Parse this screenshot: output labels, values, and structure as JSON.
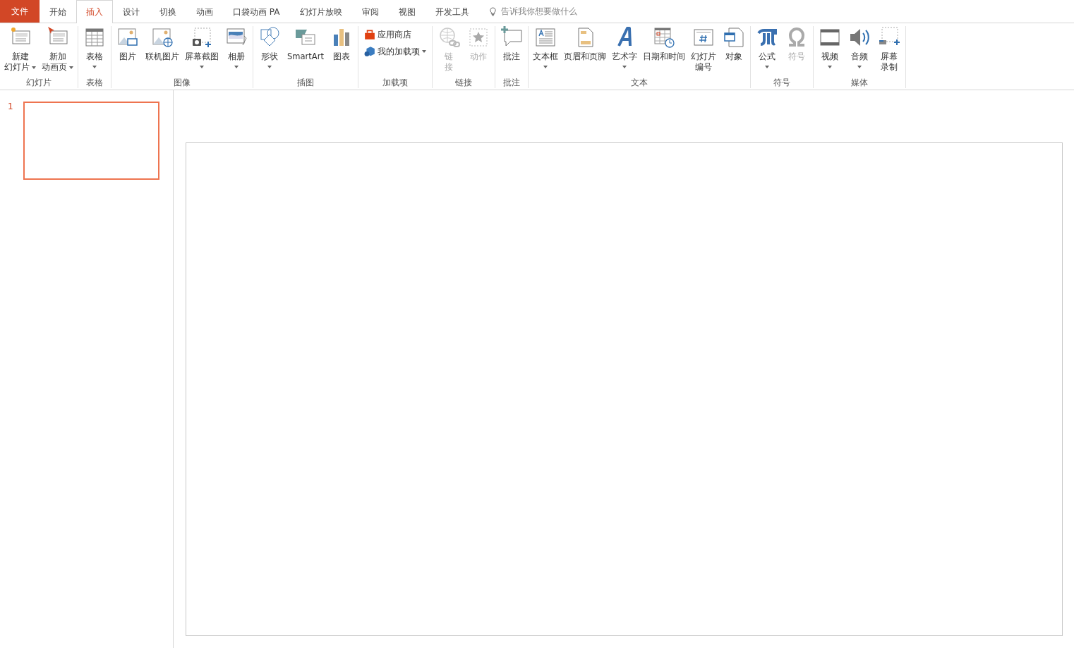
{
  "tabs": [
    {
      "label": "文件",
      "kind": "file"
    },
    {
      "label": "开始",
      "kind": "tab",
      "selected": false
    },
    {
      "label": "插入",
      "kind": "tab",
      "selected": true
    },
    {
      "label": "设计",
      "kind": "tab",
      "selected": false
    },
    {
      "label": "切换",
      "kind": "tab",
      "selected": false
    },
    {
      "label": "动画",
      "kind": "tab",
      "selected": false
    },
    {
      "label": "口袋动画 PA",
      "kind": "tab",
      "selected": false
    },
    {
      "label": "幻灯片放映",
      "kind": "tab",
      "selected": false
    },
    {
      "label": "审阅",
      "kind": "tab",
      "selected": false
    },
    {
      "label": "视图",
      "kind": "tab",
      "selected": false
    },
    {
      "label": "开发工具",
      "kind": "tab",
      "selected": false
    }
  ],
  "tell_me": {
    "placeholder": "告诉我你想要做什么"
  },
  "ribbon_groups": [
    {
      "label": "幻灯片",
      "kind": "large",
      "buttons": [
        {
          "lines": [
            "新建",
            "幻灯片"
          ],
          "kind": "newslide",
          "dropdown": true,
          "disabled": false
        },
        {
          "lines": [
            "新加",
            "动画页"
          ],
          "kind": "animslide",
          "dropdown": true,
          "disabled": false
        }
      ]
    },
    {
      "label": "表格",
      "kind": "large",
      "buttons": [
        {
          "lines": [
            "表格"
          ],
          "kind": "table",
          "dropdown": true,
          "disabled": false
        }
      ]
    },
    {
      "label": "图像",
      "kind": "large",
      "buttons": [
        {
          "lines": [
            "图片"
          ],
          "kind": "picture",
          "dropdown": false,
          "disabled": false
        },
        {
          "lines": [
            "联机图片"
          ],
          "kind": "online",
          "dropdown": false,
          "disabled": false
        },
        {
          "lines": [
            "屏幕截图"
          ],
          "kind": "screenshot",
          "dropdown": true,
          "disabled": false
        },
        {
          "lines": [
            "相册"
          ],
          "kind": "album",
          "dropdown": true,
          "disabled": false
        }
      ]
    },
    {
      "label": "插图",
      "kind": "large",
      "buttons": [
        {
          "lines": [
            "形状"
          ],
          "kind": "shapes",
          "dropdown": true,
          "disabled": false
        },
        {
          "lines": [
            "SmartArt"
          ],
          "kind": "smartart",
          "dropdown": false,
          "disabled": false
        },
        {
          "lines": [
            "图表"
          ],
          "kind": "chart",
          "dropdown": false,
          "disabled": false
        }
      ]
    },
    {
      "label": "加载项",
      "kind": "small",
      "buttons": [
        {
          "lines": [
            "应用商店"
          ],
          "kind": "store",
          "dropdown": false,
          "disabled": false
        },
        {
          "lines": [
            "我的加载项"
          ],
          "kind": "addins",
          "dropdown": true,
          "disabled": false
        }
      ]
    },
    {
      "label": "链接",
      "kind": "large",
      "buttons": [
        {
          "lines": [
            "链",
            "接"
          ],
          "kind": "link",
          "dropdown": false,
          "disabled": true
        },
        {
          "lines": [
            "动作"
          ],
          "kind": "action",
          "dropdown": false,
          "disabled": true
        }
      ]
    },
    {
      "label": "批注",
      "kind": "large",
      "buttons": [
        {
          "lines": [
            "批注"
          ],
          "kind": "comment",
          "dropdown": false,
          "disabled": false
        }
      ]
    },
    {
      "label": "文本",
      "kind": "large",
      "buttons": [
        {
          "lines": [
            "文本框"
          ],
          "kind": "textbox",
          "dropdown": true,
          "disabled": false
        },
        {
          "lines": [
            "页眉和页脚"
          ],
          "kind": "header",
          "dropdown": false,
          "disabled": false
        },
        {
          "lines": [
            "艺术字"
          ],
          "kind": "wordart",
          "dropdown": true,
          "disabled": false
        },
        {
          "lines": [
            "日期和时间"
          ],
          "kind": "datetime",
          "dropdown": false,
          "disabled": false
        },
        {
          "lines": [
            "幻灯片",
            "编号"
          ],
          "kind": "slidenumber",
          "dropdown": false,
          "disabled": false
        },
        {
          "lines": [
            "对象"
          ],
          "kind": "object",
          "dropdown": false,
          "disabled": false
        }
      ]
    },
    {
      "label": "符号",
      "kind": "large",
      "buttons": [
        {
          "lines": [
            "公式"
          ],
          "kind": "equation",
          "dropdown": true,
          "disabled": false
        },
        {
          "lines": [
            "符号"
          ],
          "kind": "symbol",
          "dropdown": false,
          "disabled": true
        }
      ]
    },
    {
      "label": "媒体",
      "kind": "large",
      "buttons": [
        {
          "lines": [
            "视频"
          ],
          "kind": "video",
          "dropdown": true,
          "disabled": false
        },
        {
          "lines": [
            "音频"
          ],
          "kind": "audio",
          "dropdown": true,
          "disabled": false
        },
        {
          "lines": [
            "屏幕",
            "录制"
          ],
          "kind": "record",
          "dropdown": false,
          "disabled": false
        }
      ]
    }
  ],
  "slides": [
    {
      "number": "1",
      "selected": true
    }
  ]
}
